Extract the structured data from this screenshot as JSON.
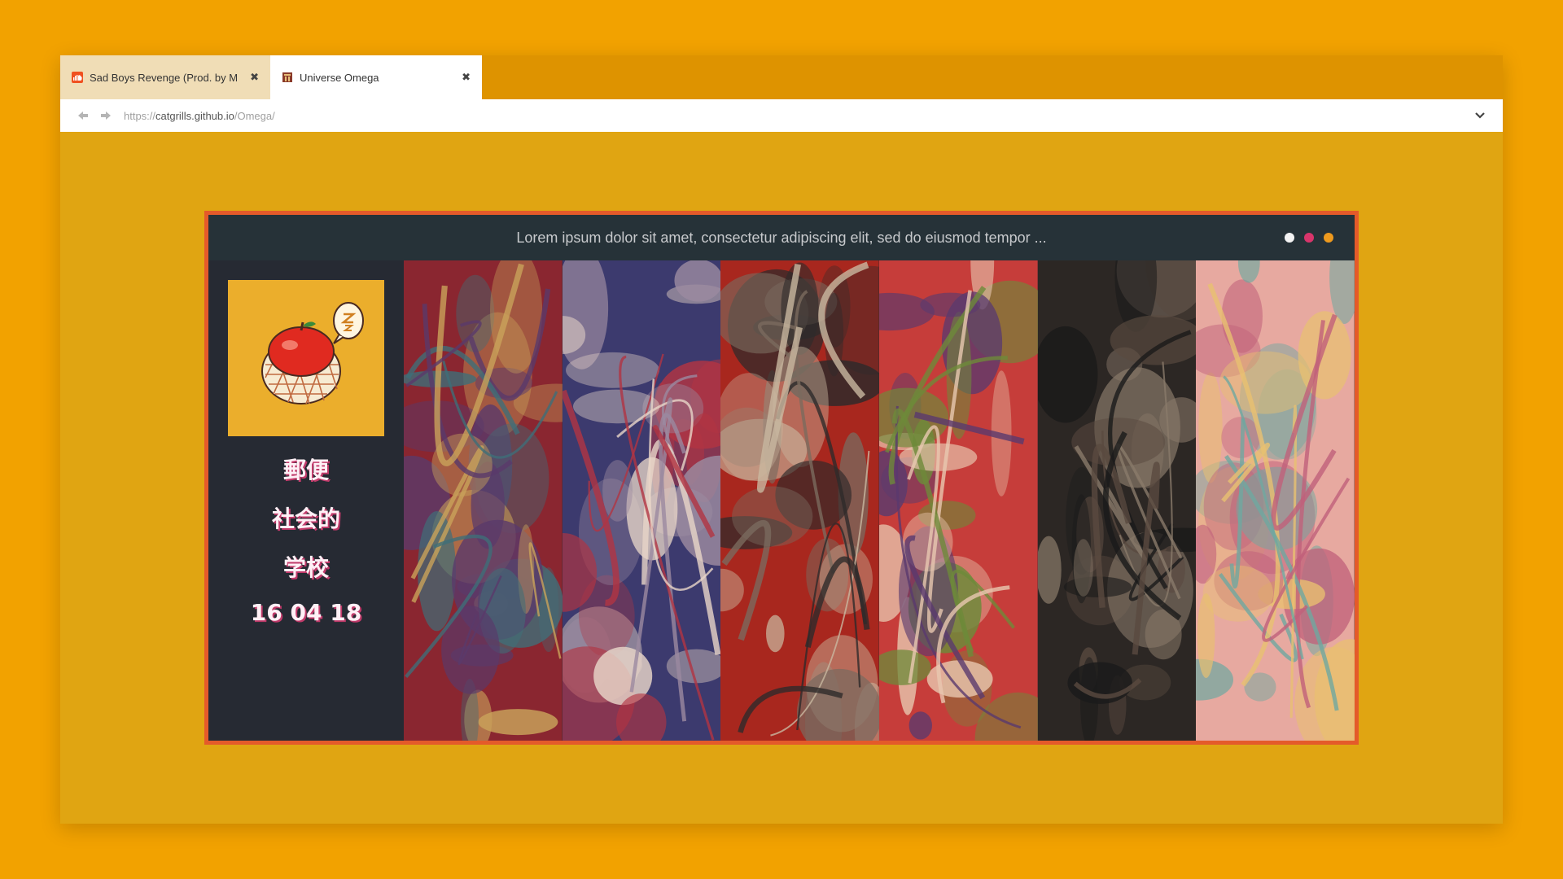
{
  "browser": {
    "tabs": [
      {
        "title": "Sad Boys Revenge (Prod. by M",
        "close_glyph": "✖",
        "favicon": "soundcloud-icon",
        "active": false
      },
      {
        "title": "Universe Omega",
        "close_glyph": "✖",
        "favicon": "shrine-icon",
        "active": true
      }
    ],
    "url": {
      "scheme": "https://",
      "host": "catgrills.github.io",
      "path": "/Omega/"
    }
  },
  "page": {
    "headline": "Lorem ipsum dolor sit amet, consectetur adipiscing elit, sed do eiusmod tempor  ...",
    "dots": [
      {
        "name": "white-dot",
        "color": "#F3F3F3"
      },
      {
        "name": "pink-dot",
        "color": "#D8356B"
      },
      {
        "name": "orange-dot",
        "color": "#EE9A1E"
      }
    ],
    "sidebar": {
      "cover_icon": "apple-in-net-icon",
      "lines": [
        "郵便",
        "社会的",
        "学校",
        "16 04 18"
      ]
    },
    "artworks": [
      {
        "name": "warrior-artwork",
        "colors": [
          "#8A2630",
          "#5A3A6A",
          "#C9A25A",
          "#3F6E78"
        ]
      },
      {
        "name": "kimono-artwork",
        "colors": [
          "#3C3A6E",
          "#B23442",
          "#9B8AA0",
          "#E8D6C8"
        ]
      },
      {
        "name": "samurai-artwork",
        "colors": [
          "#A8271E",
          "#2E2A2A",
          "#7A6A5E",
          "#C9B8A0"
        ]
      },
      {
        "name": "masks-artwork",
        "colors": [
          "#C63D3A",
          "#6E8A3A",
          "#E8C8B0",
          "#5A3A6E"
        ]
      },
      {
        "name": "demon-artwork",
        "colors": [
          "#2C2724",
          "#5A4A40",
          "#8A7A6A",
          "#1A1A1A"
        ]
      },
      {
        "name": "goddess-artwork",
        "colors": [
          "#E7A9A0",
          "#6FA8A0",
          "#E9C070",
          "#C0607A"
        ]
      }
    ]
  }
}
